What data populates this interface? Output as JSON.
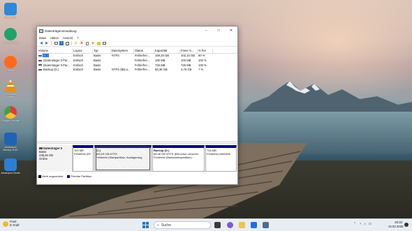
{
  "desktop": {
    "icons": [
      {
        "label": "Papierkorb",
        "color": "#2d88d8"
      },
      {
        "label": "Microsoft Edge",
        "color": "#1ea36b"
      },
      {
        "label": "Firefox",
        "color": "#ff6a1a"
      },
      {
        "label": "VLC media player",
        "color": "#f28c00"
      },
      {
        "label": "Google Chrome",
        "color": "#e53935"
      },
      {
        "label": "Ashampoo Backup 2025",
        "color": "#1f63b5"
      },
      {
        "label": "Ashampoo Deals",
        "color": "#2a7fd4"
      }
    ]
  },
  "window": {
    "title": "Datenträgerverwaltung",
    "controls": {
      "minimize": "–",
      "maximize": "□",
      "close": "✕"
    },
    "menu": [
      "Datei",
      "Aktion",
      "Ansicht",
      "?"
    ],
    "toolbar_icons": [
      "back-icon",
      "forward-icon",
      "view-icon",
      "help-icon",
      "properties-icon",
      "connect-icon",
      "delete-icon",
      "export-icon",
      "search-icon",
      "refresh-icon",
      "list-icon"
    ],
    "table": {
      "columns": [
        "Volume",
        "Layout",
        "Typ",
        "Dateisystem",
        "Status",
        "Kapazität",
        "Freier S...",
        "% frei"
      ],
      "rows": [
        [
          "(C:)",
          "Einfach",
          "Basis",
          "NTFS",
          "Fehlerfrei ...",
          "169,29 GB",
          "102,15 GB",
          "60 %"
        ],
        [
          "(Datenträger 0 Par...",
          "Einfach",
          "Basis",
          "",
          "Fehlerfrei ...",
          "100 MB",
          "100 MB",
          "100 %"
        ],
        [
          "(Datenträger 0 Par...",
          "Einfach",
          "Basis",
          "",
          "Fehlerfrei ...",
          "726 MB",
          "726 MB",
          "100 %"
        ],
        [
          "Backup (D:)",
          "Einfach",
          "Basis",
          "NTFS (BitLo...",
          "Fehlerfrei ...",
          "68,36 GB",
          "4,76 GB",
          "7 %"
        ]
      ],
      "selected_row": 0
    },
    "disk": {
      "name": "Datenträger 0",
      "type": "Basis",
      "size": "238,46 GB",
      "state": "Online",
      "partitions": [
        {
          "label": "",
          "size": "100 MB",
          "status": "Fehlerfrei (EF"
        },
        {
          "label": "(C:)",
          "size": "169,29 GB NTFS",
          "status": "Fehlerfrei (Startpartition, Auslagerung"
        },
        {
          "label": "Backup (D:)",
          "size": "68,36 GB NTFS (BitLocker-verschlü",
          "status": "Fehlerfrei (Basisdatenpartition)"
        },
        {
          "label": "",
          "size": "726 MB",
          "status": "Fehlerfrei (Wiederh"
        }
      ]
    },
    "legend": [
      {
        "label": "Nicht zugeordnet",
        "color": "#000000"
      },
      {
        "label": "Primäre Partition",
        "color": "#00008b"
      }
    ]
  },
  "taskbar": {
    "weather": {
      "title": "Frost",
      "subtitle": "In Kraft"
    },
    "search_placeholder": "Suche",
    "clock": {
      "time": "20:33",
      "date": "14.02.2025"
    }
  }
}
